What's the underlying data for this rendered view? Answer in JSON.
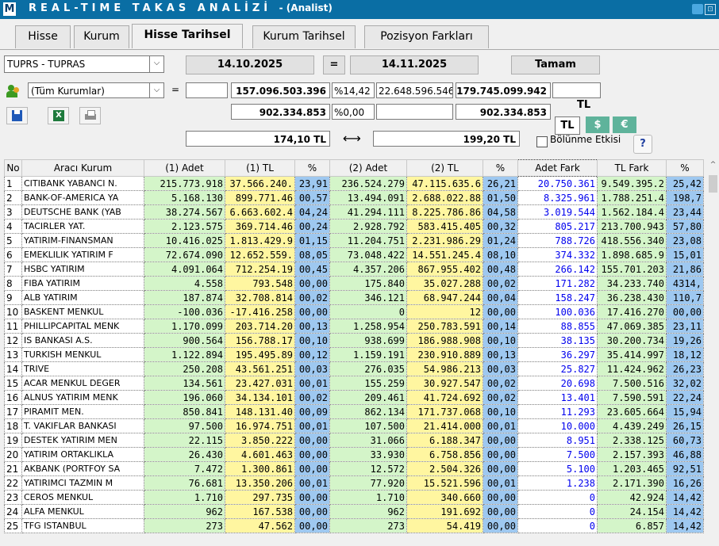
{
  "window": {
    "logo": "M",
    "title": "REAL-TIME TAKAS ANALİZİ",
    "subtitle": "- (Analist)"
  },
  "tabs": [
    {
      "label": "Hisse",
      "active": false
    },
    {
      "label": "Kurum",
      "active": false
    },
    {
      "label": "Hisse Tarihsel",
      "active": true
    },
    {
      "label": "Kurum Tarihsel",
      "active": false
    },
    {
      "label": "Pozisyon Farkları",
      "active": false
    }
  ],
  "controls": {
    "stock_select": "TUPRS - TUPRAS",
    "date_from": "14.10.2025",
    "equals": "=",
    "date_to": "14.11.2025",
    "ok_button": "Tamam",
    "institution_select": "(Tüm Kurumlar)",
    "eq_sign": "=",
    "field_blank1": "",
    "total1": "157.096.503.396",
    "pct1": "%14,42",
    "total2": "22.648.596.546",
    "total3": "179.745.099.942",
    "field_blank2": "",
    "sub1": "902.334.853",
    "pct2": "%0,00",
    "sub_blank": "",
    "sub2": "902.334.853",
    "currency_label": "TL",
    "currency_tl": "TL",
    "currency_usd": "$",
    "currency_eur": "€",
    "price_from": "174,10 TL",
    "arrow": "⟷",
    "price_to": "199,20 TL",
    "split_label": "Bölünme Etkisi",
    "help": "?"
  },
  "table": {
    "headers": [
      "No",
      "Aracı Kurum",
      "(1) Adet",
      "(1) TL",
      "%",
      "(2) Adet",
      "(2) TL",
      "%",
      "Adet Fark",
      "TL Fark",
      "%"
    ],
    "rows": [
      [
        "1",
        "CITIBANK YABANCI N.",
        "215.773.918",
        "37.566.240.",
        "23,91",
        "236.524.279",
        "47.115.635.6",
        "26,21",
        "20.750.361",
        "9.549.395.2",
        "25,42"
      ],
      [
        "2",
        "BANK-OF-AMERICA YA",
        "5.168.130",
        "899.771.46",
        "00,57",
        "13.494.091",
        "2.688.022.88",
        "01,50",
        "8.325.961",
        "1.788.251.4",
        "198,7"
      ],
      [
        "3",
        "DEUTSCHE BANK (YAB",
        "38.274.567",
        "6.663.602.4",
        "04,24",
        "41.294.111",
        "8.225.786.86",
        "04,58",
        "3.019.544",
        "1.562.184.4",
        "23,44"
      ],
      [
        "4",
        "TACIRLER YAT.",
        "2.123.575",
        "369.714.46",
        "00,24",
        "2.928.792",
        "583.415.405",
        "00,32",
        "805.217",
        "213.700.943",
        "57,80"
      ],
      [
        "5",
        "YATIRIM-FINANSMAN",
        "10.416.025",
        "1.813.429.9",
        "01,15",
        "11.204.751",
        "2.231.986.29",
        "01,24",
        "788.726",
        "418.556.340",
        "23,08"
      ],
      [
        "6",
        "EMEKLILIK YATIRIM F",
        "72.674.090",
        "12.652.559.",
        "08,05",
        "73.048.422",
        "14.551.245.4",
        "08,10",
        "374.332",
        "1.898.685.9",
        "15,01"
      ],
      [
        "7",
        "HSBC YATIRIM",
        "4.091.064",
        "712.254.19",
        "00,45",
        "4.357.206",
        "867.955.402",
        "00,48",
        "266.142",
        "155.701.203",
        "21,86"
      ],
      [
        "8",
        "FIBA YATIRIM",
        "4.558",
        "793.548",
        "00,00",
        "175.840",
        "35.027.288",
        "00,02",
        "171.282",
        "34.233.740",
        "4314,"
      ],
      [
        "9",
        "ALB YATIRIM",
        "187.874",
        "32.708.814",
        "00,02",
        "346.121",
        "68.947.244",
        "00,04",
        "158.247",
        "36.238.430",
        "110,7"
      ],
      [
        "10",
        "BASKENT MENKUL",
        "-100.036",
        "-17.416.258",
        "00,00",
        "0",
        "12",
        "00,00",
        "100.036",
        "17.416.270",
        "00,00"
      ],
      [
        "11",
        "PHILLIPCAPITAL MENK",
        "1.170.099",
        "203.714.20",
        "00,13",
        "1.258.954",
        "250.783.591",
        "00,14",
        "88.855",
        "47.069.385",
        "23,11"
      ],
      [
        "12",
        "IS BANKASI A.S.",
        "900.564",
        "156.788.17",
        "00,10",
        "938.699",
        "186.988.908",
        "00,10",
        "38.135",
        "30.200.734",
        "19,26"
      ],
      [
        "13",
        "TURKISH MENKUL",
        "1.122.894",
        "195.495.89",
        "00,12",
        "1.159.191",
        "230.910.889",
        "00,13",
        "36.297",
        "35.414.997",
        "18,12"
      ],
      [
        "14",
        "TRIVE",
        "250.208",
        "43.561.251",
        "00,03",
        "276.035",
        "54.986.213",
        "00,03",
        "25.827",
        "11.424.962",
        "26,23"
      ],
      [
        "15",
        "ACAR MENKUL DEGER",
        "134.561",
        "23.427.031",
        "00,01",
        "155.259",
        "30.927.547",
        "00,02",
        "20.698",
        "7.500.516",
        "32,02"
      ],
      [
        "16",
        "ALNUS YATIRIM MENK",
        "196.060",
        "34.134.101",
        "00,02",
        "209.461",
        "41.724.692",
        "00,02",
        "13.401",
        "7.590.591",
        "22,24"
      ],
      [
        "17",
        "PIRAMIT MEN.",
        "850.841",
        "148.131.40",
        "00,09",
        "862.134",
        "171.737.068",
        "00,10",
        "11.293",
        "23.605.664",
        "15,94"
      ],
      [
        "18",
        "T. VAKIFLAR BANKASI",
        "97.500",
        "16.974.751",
        "00,01",
        "107.500",
        "21.414.000",
        "00,01",
        "10.000",
        "4.439.249",
        "26,15"
      ],
      [
        "19",
        "DESTEK YATIRIM MEN",
        "22.115",
        "3.850.222",
        "00,00",
        "31.066",
        "6.188.347",
        "00,00",
        "8.951",
        "2.338.125",
        "60,73"
      ],
      [
        "20",
        "YATIRIM ORTAKLIKLA",
        "26.430",
        "4.601.463",
        "00,00",
        "33.930",
        "6.758.856",
        "00,00",
        "7.500",
        "2.157.393",
        "46,88"
      ],
      [
        "21",
        "AKBANK (PORTFOY SA",
        "7.472",
        "1.300.861",
        "00,00",
        "12.572",
        "2.504.326",
        "00,00",
        "5.100",
        "1.203.465",
        "92,51"
      ],
      [
        "22",
        "YATIRIMCI TAZMIN M",
        "76.681",
        "13.350.206",
        "00,01",
        "77.920",
        "15.521.596",
        "00,01",
        "1.238",
        "2.171.390",
        "16,26"
      ],
      [
        "23",
        "CEROS MENKUL",
        "1.710",
        "297.735",
        "00,00",
        "1.710",
        "340.660",
        "00,00",
        "0",
        "42.924",
        "14,42"
      ],
      [
        "24",
        "ALFA MENKUL",
        "962",
        "167.538",
        "00,00",
        "962",
        "191.692",
        "00,00",
        "0",
        "24.154",
        "14,42"
      ],
      [
        "25",
        "TFG ISTANBUL",
        "273",
        "47.562",
        "00,00",
        "273",
        "54.419",
        "00,00",
        "0",
        "6.857",
        "14,42"
      ]
    ]
  },
  "icons": [
    "excel-icon",
    "save-icon",
    "print-icon",
    "institution-icon",
    "twitter-icon"
  ]
}
